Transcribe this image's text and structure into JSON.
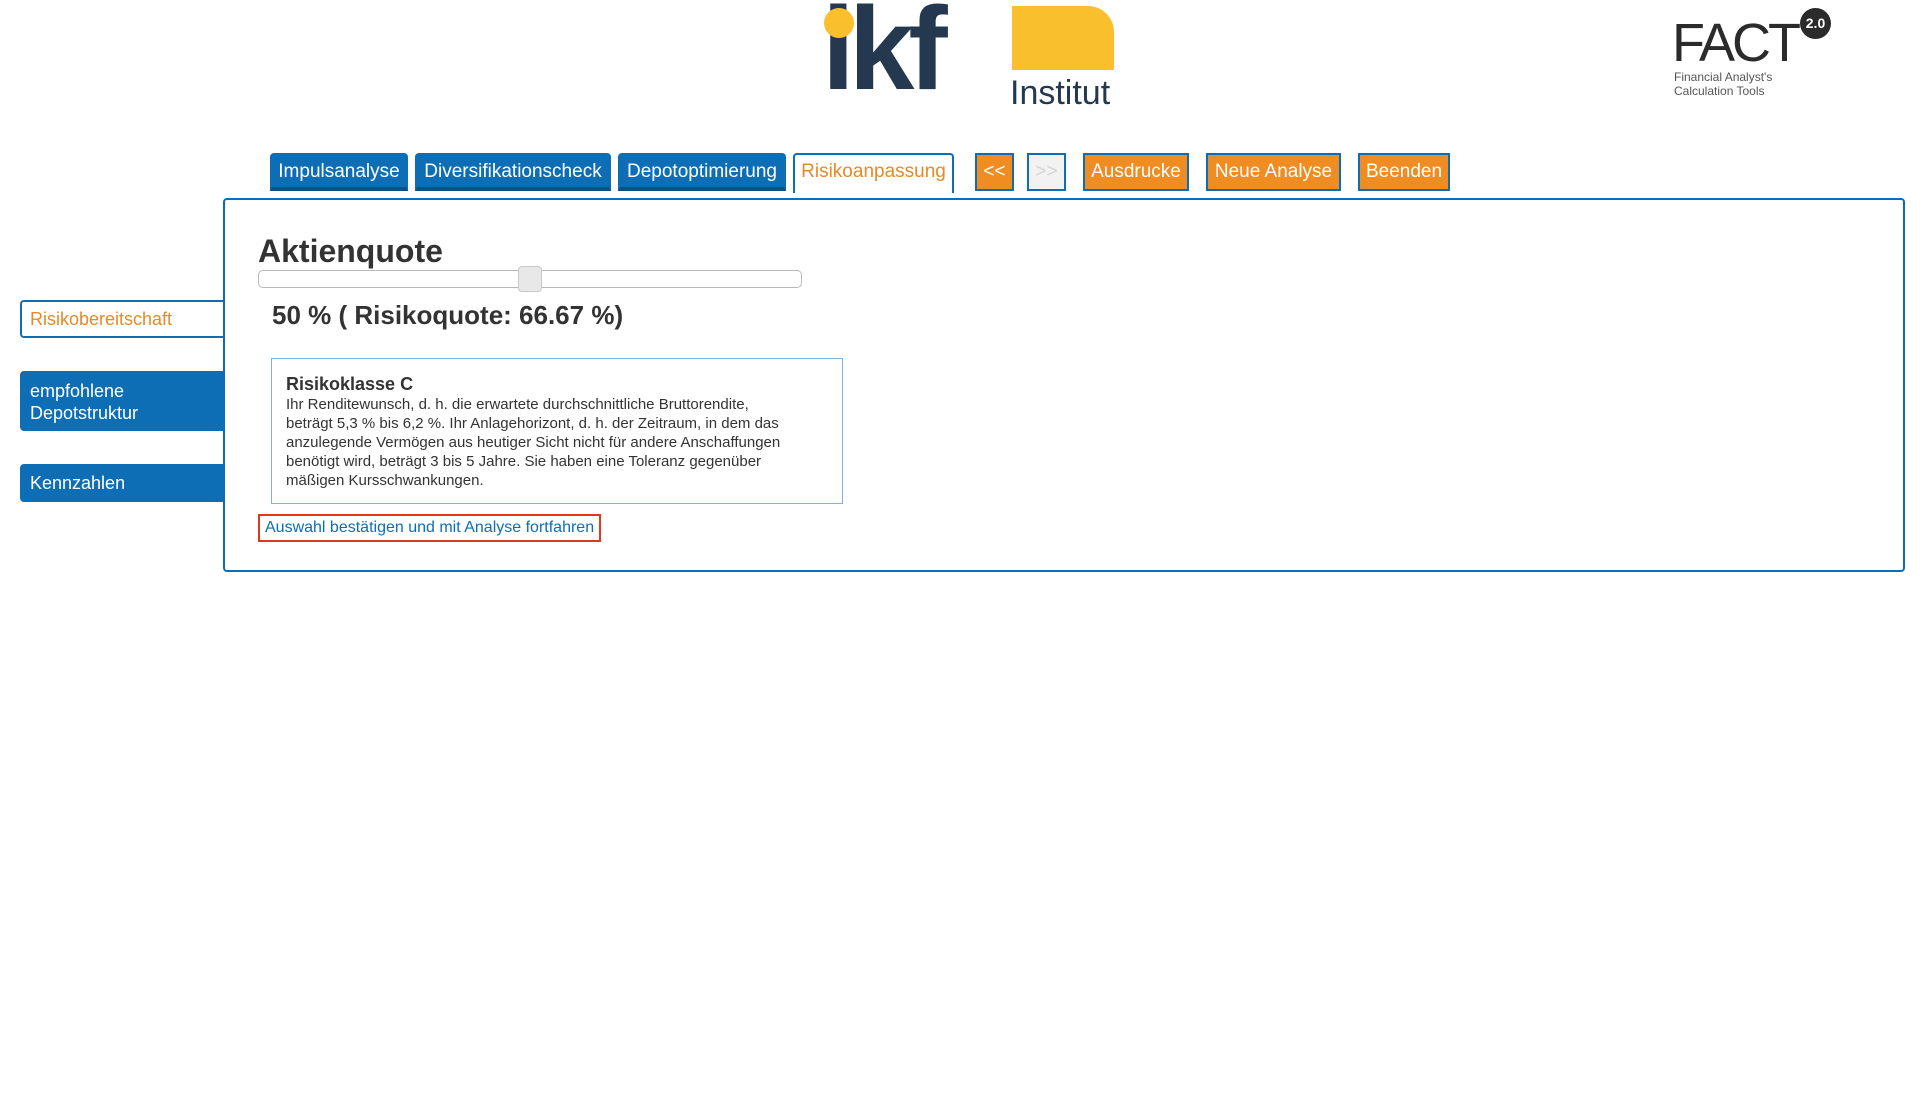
{
  "header": {
    "ikf_logo": {
      "wordmark": "ikf",
      "subtitle": "Institut"
    },
    "fact_logo": {
      "wordmark": "FACT",
      "version": "2.0",
      "subtitle_lines": [
        "Financial Analyst's",
        "Calculation Tools"
      ]
    }
  },
  "tabs": [
    {
      "label": "Impulsanalyse",
      "active": false
    },
    {
      "label": "Diversifikationscheck",
      "active": false
    },
    {
      "label": "Depotoptimierung",
      "active": false
    },
    {
      "label": "Risikoanpassung",
      "active": true
    }
  ],
  "nav_buttons": {
    "back": "<<",
    "forward": ">>",
    "forward_disabled": true,
    "print": "Ausdrucke",
    "new_analysis": "Neue Analyse",
    "quit": "Beenden"
  },
  "sidebar": {
    "items": [
      {
        "label": "Risikobereitschaft",
        "current": true
      },
      {
        "label_lines": [
          "empfohlene",
          "Depotstruktur"
        ],
        "current": false
      },
      {
        "label": "Kennzahlen",
        "current": false
      }
    ]
  },
  "main": {
    "title": "Aktienquote",
    "slider": {
      "value_percent": 50,
      "min": 0,
      "max": 100
    },
    "quota_text": "50 % ( Risikoquote: 66.67 %)",
    "risk_class": {
      "title": "Risikoklasse C",
      "lines": [
        "Ihr Renditewunsch, d. h. die erwartete durchschnittliche Bruttorendite,",
        "beträgt 5,3 % bis 6,2 %. Ihr Anlagehorizont, d. h. der Zeitraum, in dem das",
        "anzulegende Vermögen aus heutiger Sicht nicht für andere Anschaffungen",
        "benötigt wird, beträgt 3 bis 5 Jahre. Sie haben eine Toleranz gegenüber",
        "mäßigen Kursschwankungen."
      ]
    },
    "confirm_link": "Auswahl bestätigen und mit Analyse fortfahren"
  },
  "colors": {
    "primary_blue": "#0d6eb5",
    "accent_orange": "#ef8c22",
    "logo_navy": "#24384f",
    "logo_yellow": "#f9bf2c",
    "link_border_red": "#e03a1e"
  }
}
